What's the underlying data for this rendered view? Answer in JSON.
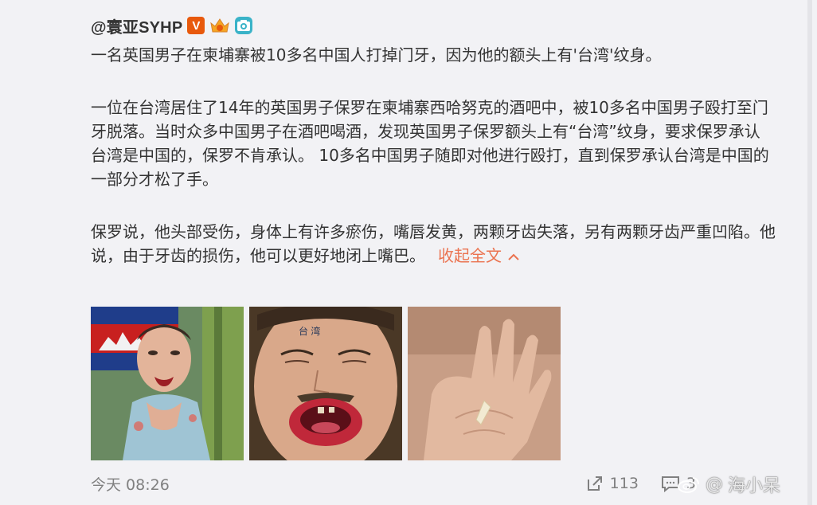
{
  "header": {
    "username": "@寰亚SYHP",
    "badges": {
      "verified_letter": "V",
      "crown_label": "",
      "camera_icon": "camera-icon"
    }
  },
  "post": {
    "paragraphs": [
      "一名英国男子在柬埔寨被10多名中国人打掉门牙，因为他的额头上有'台湾'纹身。",
      "一位在台湾居住了14年的英国男子保罗在柬埔寨西哈努克的酒吧中，被10多名中国男子殴打至门牙脱落。当时众多中国男子在酒吧喝酒，发现英国男子保罗额头上有“台湾”纹身，要求保罗承认台湾是中国的，保罗不肯承认。 10多名中国男子随即对他进行殴打，直到保罗承认台湾是中国的一部分才松了手。",
      "保罗说，他头部受伤，身体上有许多瘀伤，嘴唇发黄，两颗牙齿失落，另有两颗牙齿严重凹陷。他说，由于牙齿的损伤，他可以更好地闭上嘴巴。"
    ],
    "collapse_label": "收起全文",
    "collapse_icon": "^"
  },
  "photos": [
    {
      "name": "injured-man-photo"
    },
    {
      "name": "mouth-closeup-photo"
    },
    {
      "name": "tooth-in-hand-photo"
    }
  ],
  "footer": {
    "timestamp": "今天 08:26",
    "share_count": "113",
    "comment_count": "3"
  },
  "watermark": {
    "text": "海小呆",
    "prefix": "@"
  },
  "colors": {
    "accent": "#eb7350",
    "background": "#f2f2f5",
    "text": "#333333",
    "muted": "#808080"
  }
}
